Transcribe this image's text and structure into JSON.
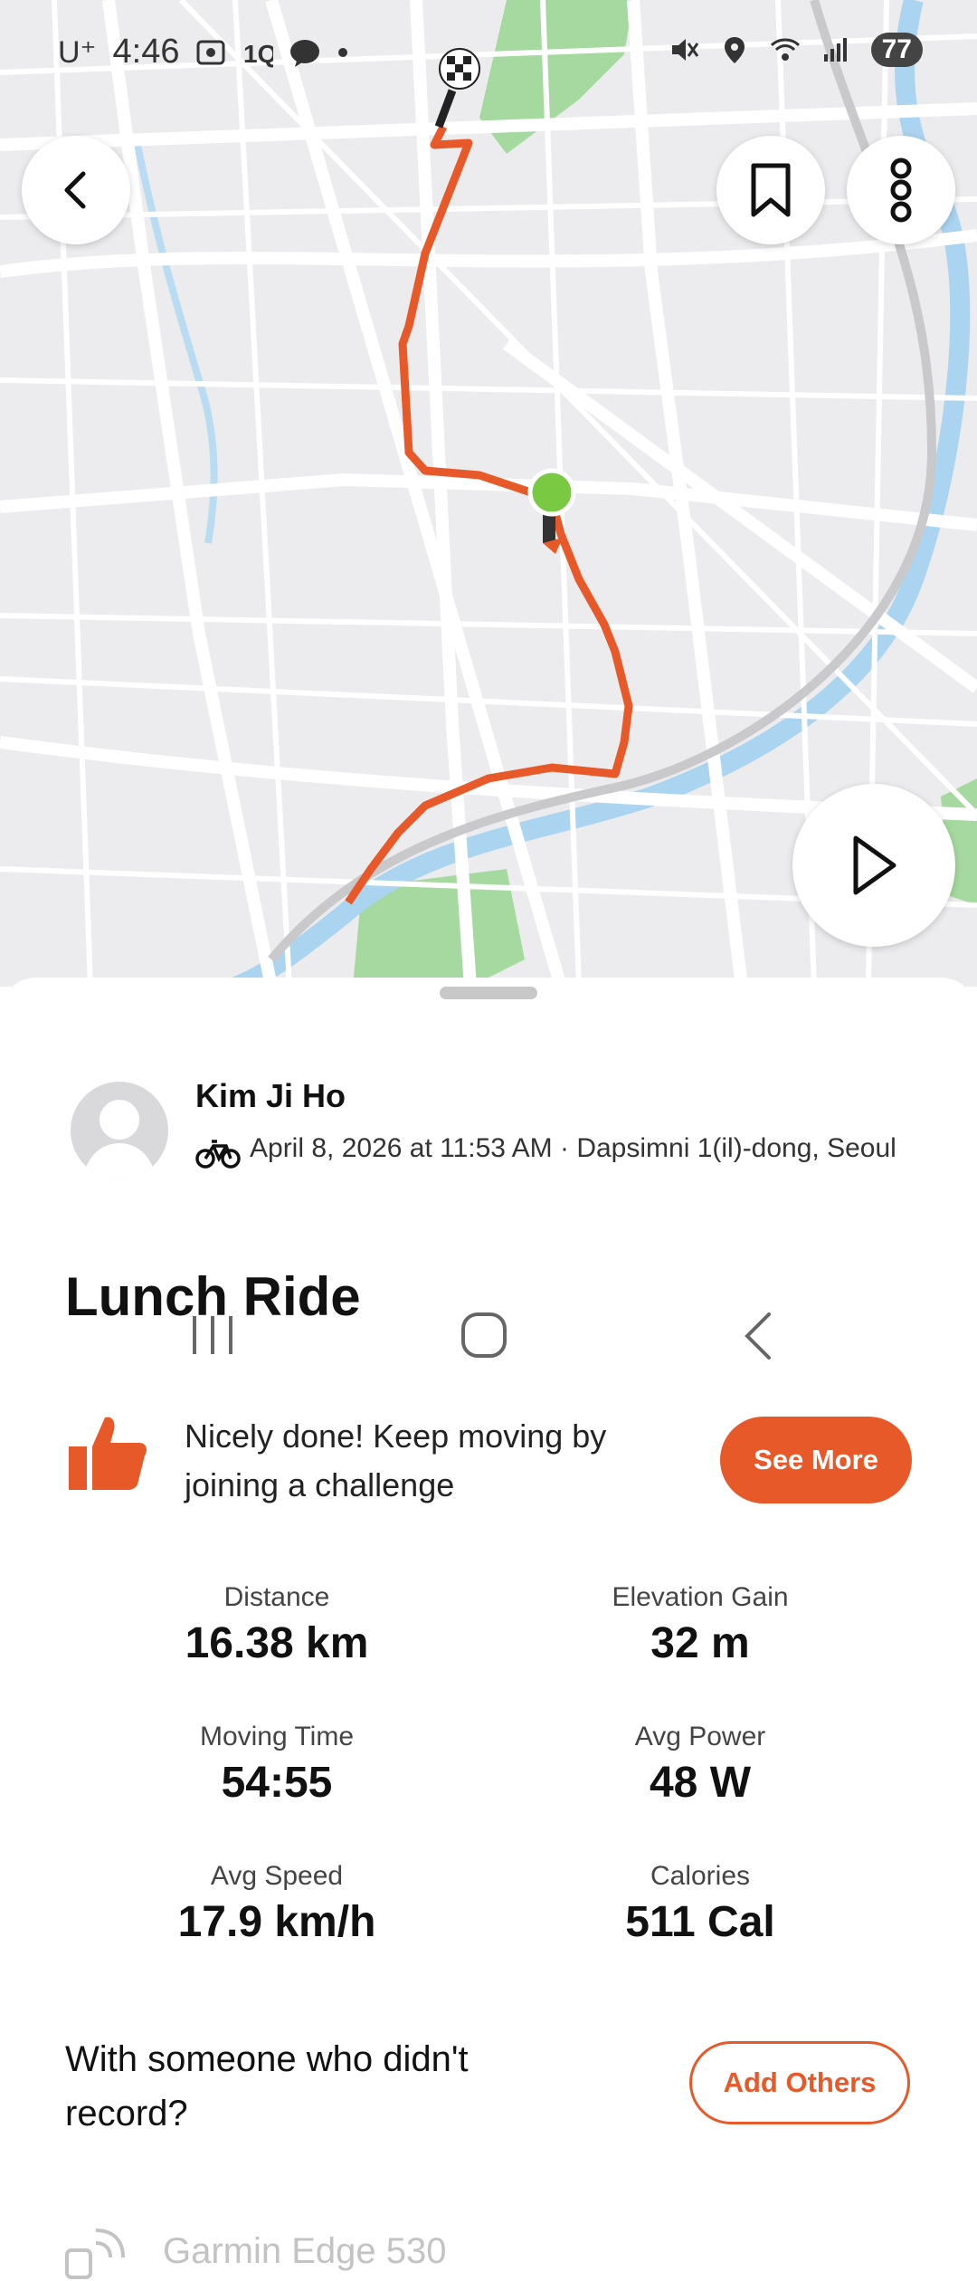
{
  "status_bar": {
    "carrier": "U⁺",
    "time": "4:46",
    "battery": "77",
    "icons": [
      "screenshot-icon",
      "1q-icon",
      "talk-icon",
      "dot-icon",
      "mute-icon",
      "location-icon",
      "wifi-icon",
      "signal-icon"
    ]
  },
  "map": {
    "route_color": "#e8592a",
    "start_marker_color": "#7ac943",
    "icons": [
      "back-arrow-icon",
      "bookmark-icon",
      "more-vertical-icon",
      "play-icon",
      "finish-flag-icon"
    ]
  },
  "athlete": {
    "name": "Kim Ji Ho",
    "meta": "April 8, 2026 at 11:53 AM · Dapsimni 1(il)-dong, Seoul"
  },
  "activity": {
    "title": "Lunch Ride"
  },
  "promo": {
    "text": "Nicely done! Keep moving by joining a challenge",
    "button": "See More"
  },
  "stats": [
    {
      "label": "Distance",
      "value": "16.38 km"
    },
    {
      "label": "Elevation Gain",
      "value": "32 m"
    },
    {
      "label": "Moving Time",
      "value": "54:55"
    },
    {
      "label": "Avg Power",
      "value": "48 W"
    },
    {
      "label": "Avg Speed",
      "value": "17.9 km/h"
    },
    {
      "label": "Calories",
      "value": "511 Cal"
    }
  ],
  "others": {
    "text": "With someone who didn't record?",
    "button": "Add Others"
  },
  "device": {
    "name": "Garmin Edge 530"
  },
  "colors": {
    "accent": "#e8592a"
  }
}
